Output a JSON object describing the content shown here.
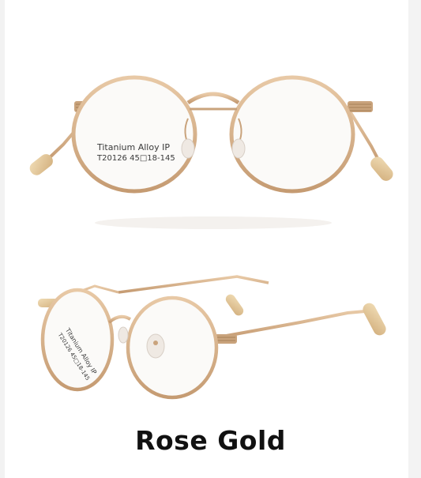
{
  "product": {
    "lens_imprint_line1": "Titanium Alloy IP",
    "lens_imprint_line2": "T20126 45□18-145",
    "color_name": "Rose Gold"
  },
  "colors": {
    "frame": "#d9b38c",
    "frame_shadow": "#b98f66",
    "tip": "#e3c79a",
    "background": "#ffffff"
  }
}
